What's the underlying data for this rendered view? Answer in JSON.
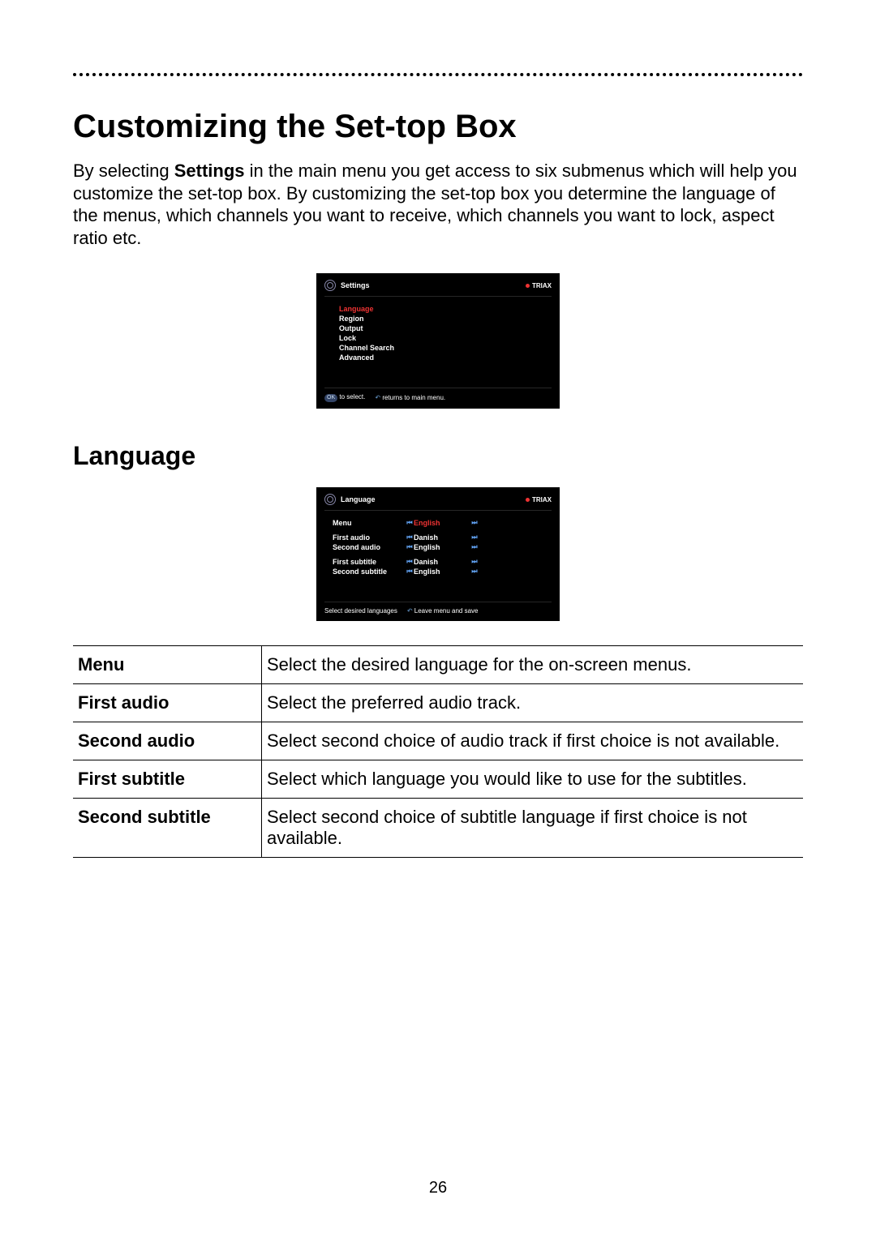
{
  "page_number": "26",
  "heading": "Customizing the Set-top Box",
  "intro_prefix": "By selecting ",
  "intro_bold": "Settings",
  "intro_suffix": " in the main menu you get access to six submenus which will help you customize the set-top box. By customizing the set-top box you determine the language of the menus, which channels you want to receive, which channels you want to lock, aspect ratio etc.",
  "subheading": "Language",
  "stb1": {
    "title": "Settings",
    "brand": "TRIAX",
    "items": [
      "Language",
      "Region",
      "Output",
      "Lock",
      "Channel Search",
      "Advanced"
    ],
    "footer_ok": "OK",
    "footer_select": "to select.",
    "footer_back": "returns to main menu."
  },
  "stb2": {
    "title": "Language",
    "brand": "TRIAX",
    "rows": [
      {
        "label": "Menu",
        "value": "English",
        "sel": true
      },
      {
        "label": "First audio",
        "value": "Danish"
      },
      {
        "label": "Second audio",
        "value": "English"
      },
      {
        "label": "First subtitle",
        "value": "Danish"
      },
      {
        "label": "Second subtitle",
        "value": "English"
      }
    ],
    "footer_left": "Select desired languages",
    "footer_right": "Leave menu and save"
  },
  "defs": [
    {
      "term": "Menu",
      "desc": "Select the desired language for the on-screen menus."
    },
    {
      "term": "First audio",
      "desc": "Select the preferred audio track."
    },
    {
      "term": "Second audio",
      "desc": "Select second choice of audio track if first choice is not available."
    },
    {
      "term": "First subtitle",
      "desc": "Select which language you would like to use for the subtitles."
    },
    {
      "term": "Second subtitle",
      "desc": "Select second choice of subtitle language if first choice is not available."
    }
  ]
}
